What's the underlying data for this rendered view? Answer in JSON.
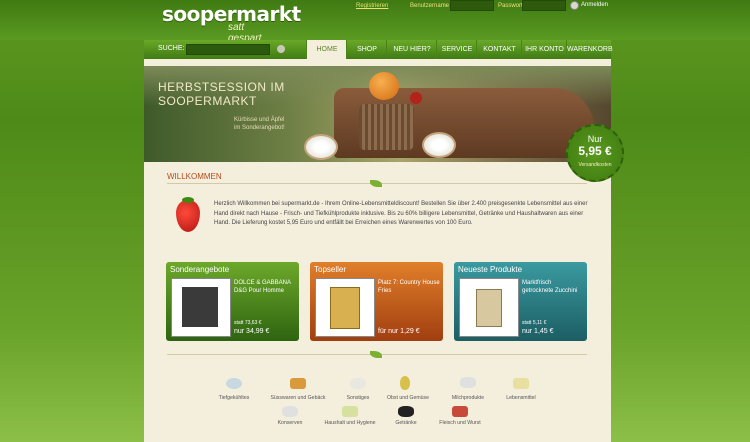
{
  "brand": {
    "name": "soopermarkt",
    "tagline": "satt gespart"
  },
  "login": {
    "register": "Registrieren",
    "username_label": "Benutzername",
    "username_value": "",
    "password_label": "Passwort",
    "password_value": "",
    "submit": "Anmelden"
  },
  "search": {
    "label": "SUCHE:",
    "value": ""
  },
  "nav": [
    "HOME",
    "SHOP",
    "NEU HIER?",
    "SERVICE",
    "KONTAKT",
    "IHR KONTO",
    "WARENKORB"
  ],
  "banner": {
    "title_line1": "HERBSTSESSION IM",
    "title_line2": "SOOPERMARKT",
    "sub_line1": "Kürbisse und Äpfel",
    "sub_line2": "im Sonderangebot!"
  },
  "shipping_badge": {
    "nur": "Nur",
    "price": "5,95 €",
    "label": "Versandkosten"
  },
  "welcome": {
    "title": "WILLKOMMEN",
    "text": "Herzlich Willkommen bei supermarkt.de - Ihrem Online-Lebensmitteldiscount! Bestellen Sie über 2.400 preisgesenkte Lebensmittel aus einer Hand direkt nach Hause - Frisch- und Tiefkühlprodukte inklusive. Bis zu 60% billigere Lebensmittel, Getränke und Haushaltwaren aus einer Hand. Die Lieferung kostet 5,95 Euro und entfällt bei Erreichen eines Warenwertes von 100 Euro."
  },
  "boxes": [
    {
      "head": "Sonderangebote",
      "name": "DOLCE & GABBANA D&G Pour Homme",
      "old": "statt 73,63 €",
      "new": "nur 34,99 €"
    },
    {
      "head": "Topseller",
      "name": "Platz 7: Country House Fries",
      "old": "",
      "new": "für nur 1,29 €"
    },
    {
      "head": "Neueste Produkte",
      "name": "Marktfrisch getrocknete Zucchini",
      "old": "statt 5,11 €",
      "new": "nur 1,45 €"
    }
  ],
  "categories": [
    "Tiefgekühltes",
    "Süsswaren und Gebäck",
    "Sonstiges",
    "Obst und Gemüse",
    "Milchprodukte",
    "Lebensmittel",
    "Konserven",
    "Haushalt und Hygiene",
    "Getränke",
    "Fleisch und Wurst"
  ]
}
